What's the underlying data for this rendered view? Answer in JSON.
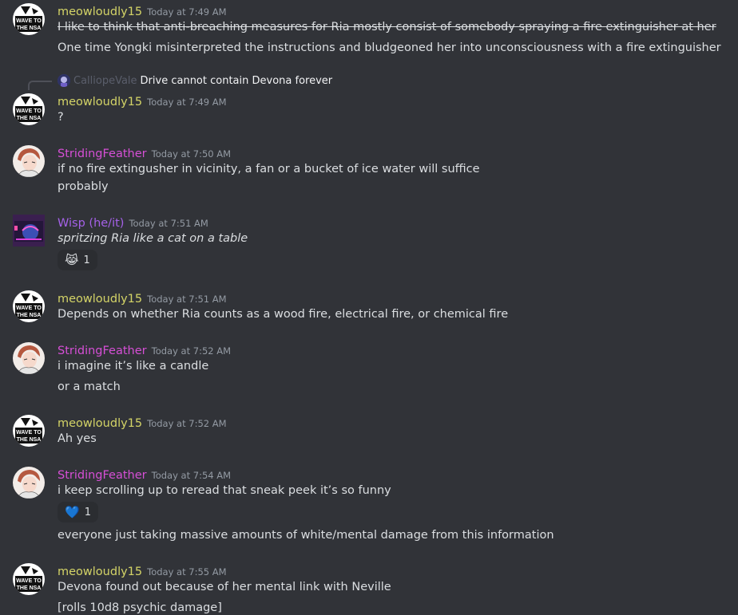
{
  "messages": [
    {
      "username": "meowloudly15",
      "timestamp": "Today at 7:49 AM",
      "lines": [
        "I like to think that anti-breaching measures for Ria mostly consist of somebody spraying a fire extinguisher at her",
        "One time Yongki misinterpreted the instructions and bludgeoned her into unconsciousness with a fire extinguisher"
      ]
    },
    {
      "reply": {
        "username": "CalliopeVale",
        "text": "Drive cannot contain Devona forever"
      },
      "username": "meowloudly15",
      "timestamp": "Today at 7:49 AM",
      "lines": [
        "?"
      ]
    },
    {
      "username": "StridingFeather",
      "timestamp": "Today at 7:50 AM",
      "lines": [
        "if no fire extingusher in vicinity, a fan or a bucket of ice water will suffice",
        "probably"
      ]
    },
    {
      "username": "Wisp (he/it)",
      "timestamp": "Today at 7:51 AM",
      "lines": [
        "spritzing Ria like a cat on a table"
      ],
      "reaction": {
        "emoji": "😹",
        "count": "1"
      }
    },
    {
      "username": "meowloudly15",
      "timestamp": "Today at 7:51 AM",
      "lines": [
        "Depends on whether Ria counts as a wood fire, electrical fire, or chemical fire"
      ]
    },
    {
      "username": "StridingFeather",
      "timestamp": "Today at 7:52 AM",
      "lines": [
        "i imagine it’s like a candle",
        "or a match"
      ]
    },
    {
      "username": "meowloudly15",
      "timestamp": "Today at 7:52 AM",
      "lines": [
        "Ah yes"
      ]
    },
    {
      "username": "StridingFeather",
      "timestamp": "Today at 7:54 AM",
      "lines": [
        "i keep scrolling up to reread that sneak peek it’s so funny",
        "everyone just taking massive amounts of white/mental damage from this information"
      ],
      "reaction": {
        "emoji": "💙",
        "count": "1"
      }
    },
    {
      "username": "meowloudly15",
      "timestamp": "Today at 7:55 AM",
      "lines": [
        "Devona found out because of her mental link with Neville",
        "[rolls 10d8 psychic damage]"
      ]
    }
  ],
  "avatar_text": {
    "line1": "WAVE TO",
    "line2": "THE NSA"
  },
  "colors": {
    "background": "#313338",
    "meowloudly15": "#d4d467",
    "StridingFeather": "#d64fd6",
    "wisp": "#a561e8",
    "timestamp": "#949ba4",
    "text": "#dbdee1"
  }
}
